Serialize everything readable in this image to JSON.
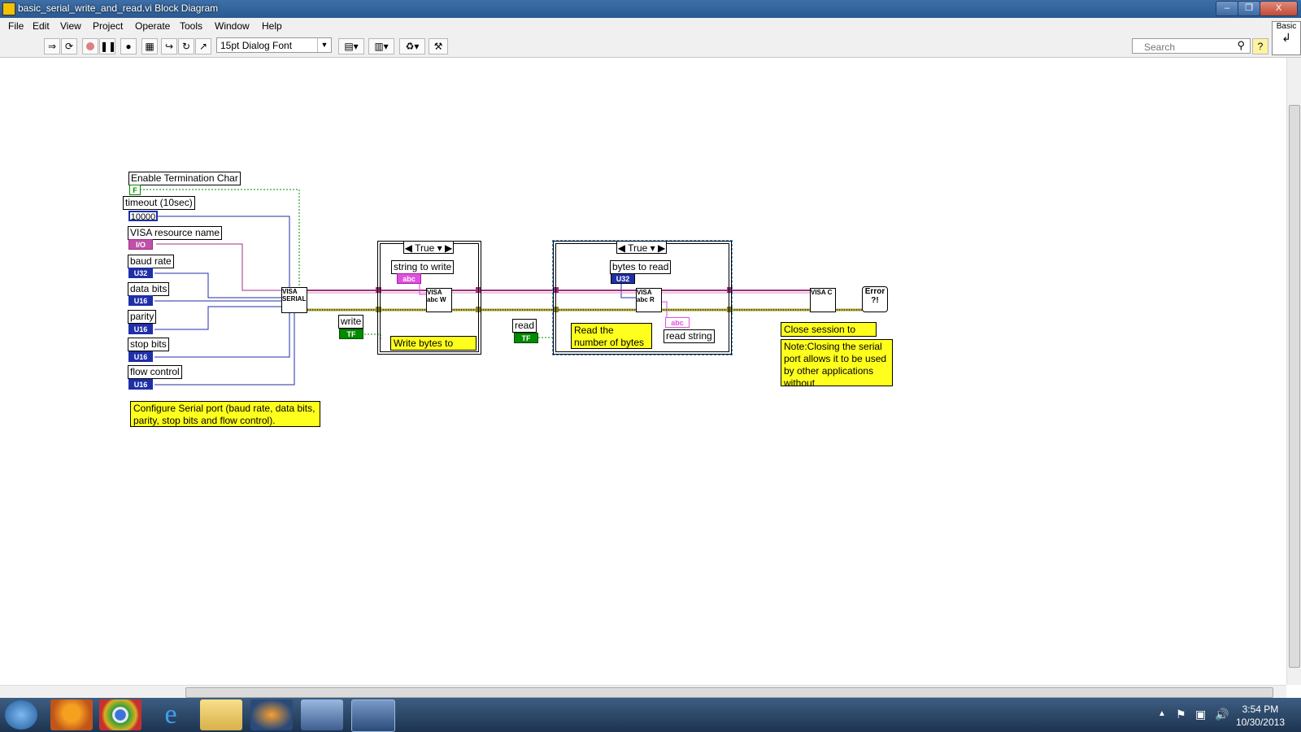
{
  "window": {
    "title": "basic_serial_write_and_read.vi Block Diagram",
    "minimize": "–",
    "restore": "❐",
    "close": "X"
  },
  "menu": [
    "File",
    "Edit",
    "View",
    "Project",
    "Operate",
    "Tools",
    "Window",
    "Help"
  ],
  "toolbar": {
    "font": "15pt Dialog Font",
    "search_placeholder": "Search",
    "palette_label": "Basic",
    "help": "?"
  },
  "diagram": {
    "labels": {
      "enable_term": "Enable Termination Char",
      "timeout": "timeout (10sec)",
      "visa_resource": "VISA resource name",
      "baud_rate": "baud rate",
      "data_bits": "data bits",
      "parity": "parity",
      "stop_bits": "stop bits",
      "flow_control": "flow control",
      "write": "write",
      "read": "read",
      "string_to_write": "string to write",
      "bytes_to_read": "bytes to read",
      "read_string": "read string"
    },
    "constants": {
      "enable_term": "F",
      "timeout": "10000",
      "visa_io": "I/O",
      "baud": "U32",
      "data_bits": "U16",
      "parity": "U16",
      "stop_bits": "U16",
      "flow": "U16",
      "write_bool": "TF",
      "read_bool": "TF",
      "string_to_write": "abc",
      "bytes_to_read": "U32",
      "read_string": "abc"
    },
    "case_write": "True",
    "case_read": "True",
    "vi": {
      "config": "VISA SERIAL",
      "write": "VISA abc W",
      "read": "VISA abc R",
      "close": "VISA C",
      "error": "Error ?!"
    },
    "notes": {
      "configure": "Configure Serial port (baud rate, data bits, parity, stop bits and flow control).",
      "write_bytes": "Write bytes to port.",
      "read_bytes": "Read the number of bytes specified.",
      "close_session": "Close session to port.",
      "closing_note": "Note:Closing the serial port allows it to be used by other applications without"
    }
  },
  "taskbar": {
    "time": "3:54 PM",
    "date": "10/30/2013"
  },
  "colors": {
    "visa_wire": "#a0307c",
    "error_wire": "#a8a230",
    "int_wire": "#1f2fa8",
    "bool_wire": "#008a00",
    "note": "#ffff1e"
  }
}
